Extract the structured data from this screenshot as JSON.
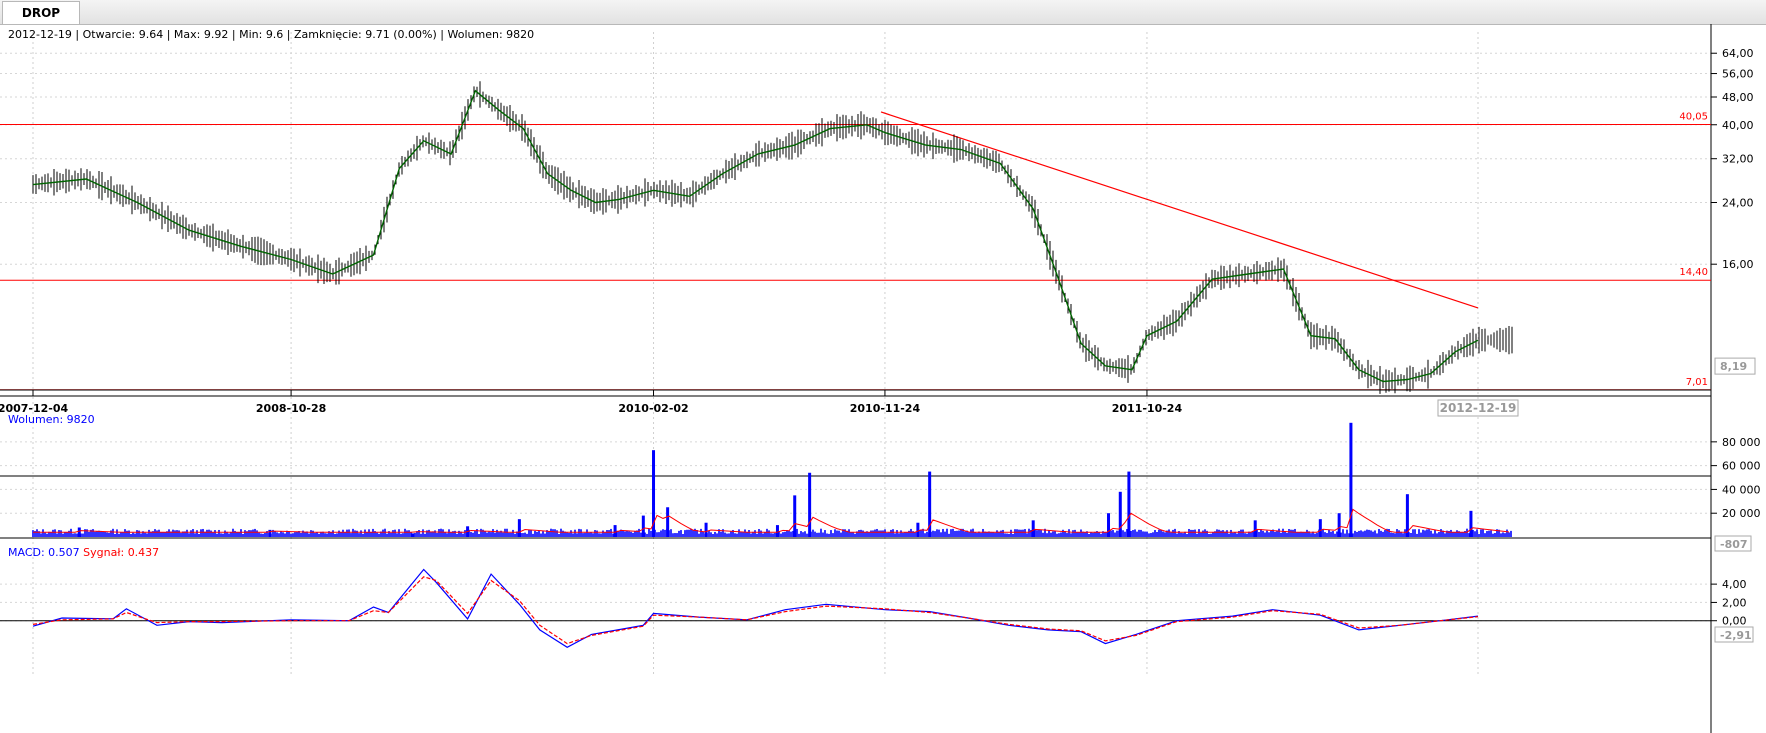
{
  "tab": {
    "title": "DROP"
  },
  "info": {
    "date": "2012-12-19",
    "open_label": "Otwarcie:",
    "open": "9.64",
    "max_label": "Max:",
    "max": "9.92",
    "min_label": "Min:",
    "min": "9.6",
    "close_label": "Zamknięcie:",
    "close": "9.71 (0.00%)",
    "volume_label": "Wolumen:",
    "volume": "9820"
  },
  "volume_panel": {
    "label": "Wolumen: 9820",
    "last_value": "-807"
  },
  "macd_panel": {
    "macd_label": "MACD: 0.507",
    "signal_label": "Sygnał: 0.437",
    "last_value": "-2,91"
  },
  "price_axis": {
    "current_label": "8,19"
  },
  "x_date_labels": [
    "2007-12-04",
    "2008-10-28",
    "2010-02-02",
    "2010-11-24",
    "2011-10-24"
  ],
  "last_date_label": "2012-12-19",
  "colors": {
    "price": "#000000",
    "moving_average": "#006400",
    "levels": "#ff0000",
    "volume": "#0000ff",
    "macd": "#0000ff",
    "signal": "#ff0000"
  },
  "chart_data": [
    {
      "type": "line",
      "scale": "log",
      "y_ticks": [
        "64,00",
        "56,00",
        "48,00",
        "40,00",
        "32,00",
        "24,00",
        "16,00"
      ],
      "y_tick_values": [
        64,
        56,
        48,
        40,
        32,
        24,
        16
      ],
      "x_tick_labels": [
        "2007-12-04",
        "2008-10-28",
        "2010-02-02",
        "2010-11-24",
        "2011-10-24"
      ],
      "x_range": [
        "2007-12-04",
        "2012-12-19"
      ],
      "ylim": [
        7.0,
        68
      ],
      "horizontal_levels": [
        {
          "label": "40,05",
          "value": 40.05
        },
        {
          "label": "14,40",
          "value": 14.4
        },
        {
          "label": "7,01",
          "value": 7.01
        }
      ],
      "trendline": {
        "x": [
          "2010-11-19",
          "2012-12-19"
        ],
        "y": [
          43.5,
          12.0
        ]
      },
      "series": [
        {
          "x": [
            "2007-12-04",
            "2008-02-10",
            "2008-04-15",
            "2008-06-20",
            "2008-08-25",
            "2008-10-28",
            "2008-12-20",
            "2009-02-10",
            "2009-03-15",
            "2009-04-15",
            "2009-05-20",
            "2009-06-20",
            "2009-07-20",
            "2009-08-20",
            "2009-09-20",
            "2009-10-20",
            "2009-11-20",
            "2009-12-20",
            "2010-02-02",
            "2010-03-20",
            "2010-05-01",
            "2010-06-15",
            "2010-08-01",
            "2010-09-15",
            "2010-11-01",
            "2010-11-24",
            "2011-01-15",
            "2011-03-01",
            "2011-04-20",
            "2011-06-01",
            "2011-07-01",
            "2011-08-01",
            "2011-09-01",
            "2011-10-05",
            "2011-10-24",
            "2011-12-01",
            "2012-01-15",
            "2012-03-01",
            "2012-04-15",
            "2012-05-20",
            "2012-06-20",
            "2012-07-20",
            "2012-08-20",
            "2012-09-20",
            "2012-10-20",
            "2012-11-20",
            "2012-12-19"
          ],
          "y": [
            27,
            28,
            24,
            20,
            18,
            16.5,
            15,
            17,
            30,
            36,
            33,
            50,
            44,
            39,
            29,
            26,
            24,
            24.5,
            26,
            25,
            29,
            33,
            35,
            39,
            40,
            38,
            35,
            34,
            31,
            23,
            15,
            9.5,
            8.2,
            8.0,
            10,
            11,
            14.5,
            15,
            15.5,
            10,
            9.8,
            8.0,
            7.4,
            7.5,
            7.8,
            9,
            9.71
          ]
        }
      ]
    },
    {
      "type": "bar",
      "label": "Wolumen: 9820",
      "y_ticks": [
        "80 000",
        "60 000",
        "40 000",
        "20 000"
      ],
      "y_tick_values": [
        80000,
        60000,
        40000,
        20000
      ],
      "ylim": [
        0,
        95000
      ],
      "x": [
        "2008-02-01",
        "2008-10-01",
        "2009-04-01",
        "2009-06-10",
        "2009-08-15",
        "2009-12-15",
        "2010-01-20",
        "2010-02-02",
        "2010-02-20",
        "2010-04-10",
        "2010-07-10",
        "2010-08-01",
        "2010-08-20",
        "2011-01-05",
        "2011-01-20",
        "2011-06-01",
        "2011-09-05",
        "2011-09-20",
        "2011-10-01",
        "2012-03-10",
        "2012-06-01",
        "2012-06-25",
        "2012-07-10",
        "2012-09-20",
        "2012-12-10"
      ],
      "values": [
        8000,
        6000,
        3000,
        9000,
        15000,
        10000,
        18000,
        73000,
        25000,
        12000,
        10000,
        35000,
        54000,
        12000,
        55000,
        14000,
        20000,
        38000,
        55000,
        14000,
        15000,
        20000,
        96000,
        36000,
        22000
      ]
    },
    {
      "type": "line",
      "label": "MACD",
      "y_ticks": [
        "4,00",
        "2,00",
        "0,00"
      ],
      "y_tick_values": [
        4,
        2,
        0
      ],
      "ylim": [
        -3.2,
        6.2
      ],
      "series": [
        {
          "name": "MACD: 0.507",
          "x": [
            "2007-12-04",
            "2008-01-10",
            "2008-03-15",
            "2008-04-01",
            "2008-05-10",
            "2008-06-20",
            "2008-08-01",
            "2008-10-28",
            "2009-01-10",
            "2009-02-10",
            "2009-03-01",
            "2009-04-15",
            "2009-05-01",
            "2009-06-10",
            "2009-07-10",
            "2009-08-15",
            "2009-09-10",
            "2009-10-15",
            "2009-11-15",
            "2010-01-20",
            "2010-02-02",
            "2010-04-01",
            "2010-06-01",
            "2010-07-20",
            "2010-09-10",
            "2010-11-24",
            "2011-01-20",
            "2011-03-10",
            "2011-05-01",
            "2011-06-20",
            "2011-08-01",
            "2011-09-01",
            "2011-10-10",
            "2011-12-01",
            "2012-02-10",
            "2012-04-01",
            "2012-06-01",
            "2012-07-20",
            "2012-09-10",
            "2012-11-01",
            "2012-12-19"
          ],
          "y": [
            -0.6,
            0.3,
            0.2,
            1.3,
            -0.5,
            -0.1,
            -0.2,
            0.1,
            0.0,
            1.5,
            0.9,
            5.6,
            4.2,
            0.2,
            5.1,
            1.8,
            -1.0,
            -2.9,
            -1.5,
            -0.5,
            0.8,
            0.4,
            0.1,
            1.2,
            1.8,
            1.2,
            1.0,
            0.3,
            -0.5,
            -1.0,
            -1.2,
            -2.5,
            -1.5,
            0.0,
            0.5,
            1.2,
            0.6,
            -1.0,
            -0.5,
            0.0,
            0.507
          ]
        },
        {
          "name": "Sygnał: 0.437",
          "x": [
            "2007-12-04",
            "2008-01-10",
            "2008-03-15",
            "2008-04-01",
            "2008-05-10",
            "2008-06-20",
            "2008-08-01",
            "2008-10-28",
            "2009-01-10",
            "2009-02-10",
            "2009-03-01",
            "2009-04-15",
            "2009-05-01",
            "2009-06-10",
            "2009-07-10",
            "2009-08-15",
            "2009-09-10",
            "2009-10-15",
            "2009-11-15",
            "2010-01-20",
            "2010-02-02",
            "2010-04-01",
            "2010-06-01",
            "2010-07-20",
            "2010-09-10",
            "2010-11-24",
            "2011-01-20",
            "2011-03-10",
            "2011-05-01",
            "2011-06-20",
            "2011-08-01",
            "2011-09-01",
            "2011-10-10",
            "2011-12-01",
            "2012-02-10",
            "2012-04-01",
            "2012-06-01",
            "2012-07-20",
            "2012-09-10",
            "2012-11-01",
            "2012-12-19"
          ],
          "y": [
            -0.4,
            0.1,
            0.2,
            0.9,
            -0.2,
            -0.1,
            -0.1,
            0.0,
            0.0,
            1.1,
            0.9,
            4.8,
            4.4,
            0.8,
            4.4,
            2.2,
            -0.5,
            -2.5,
            -1.6,
            -0.6,
            0.6,
            0.4,
            0.1,
            1.0,
            1.6,
            1.3,
            0.9,
            0.3,
            -0.4,
            -0.9,
            -1.1,
            -2.2,
            -1.6,
            -0.1,
            0.4,
            1.1,
            0.7,
            -0.8,
            -0.5,
            0.0,
            0.437
          ]
        }
      ]
    }
  ]
}
